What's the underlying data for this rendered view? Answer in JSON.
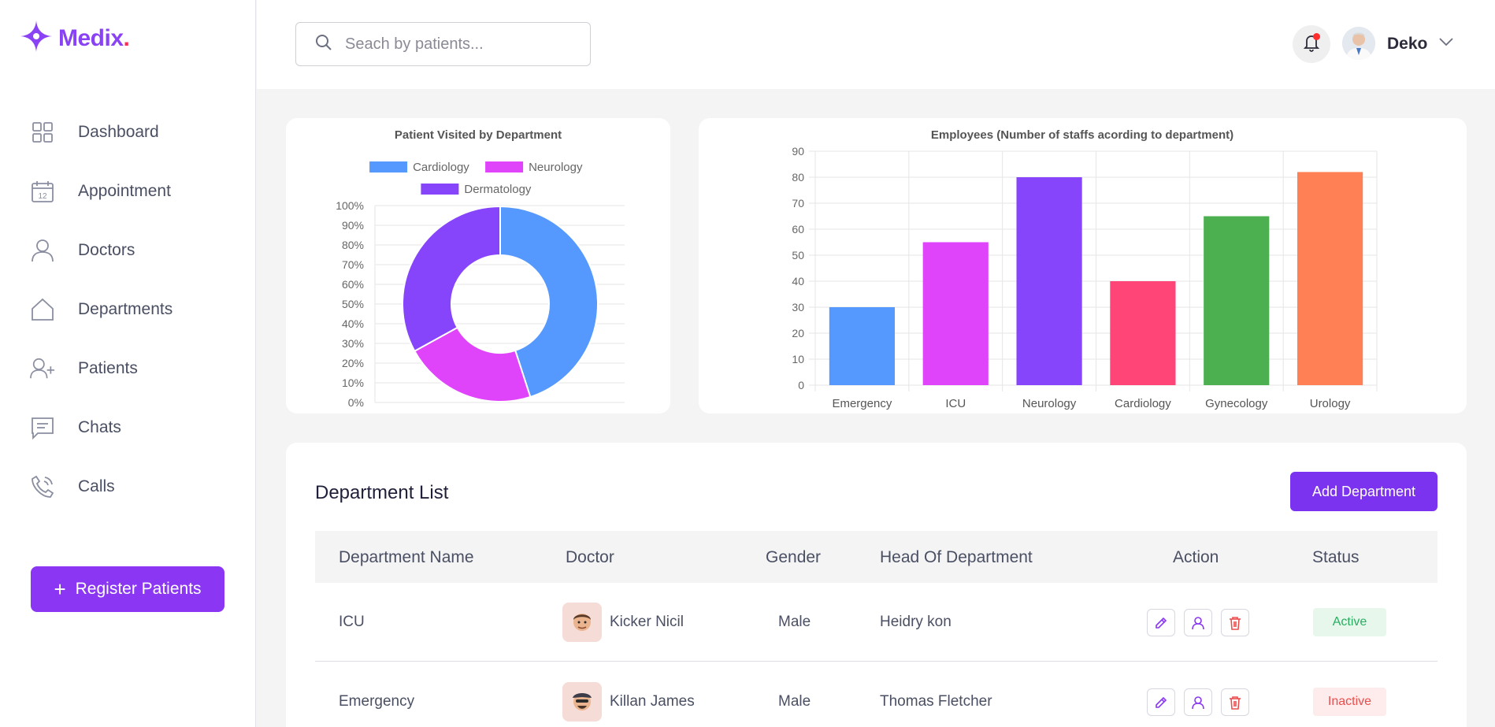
{
  "brand": {
    "name": "Medix",
    "dot": "."
  },
  "sidebar": {
    "items": [
      {
        "label": "Dashboard",
        "icon": "grid-icon"
      },
      {
        "label": "Appointment",
        "icon": "calendar-icon"
      },
      {
        "label": "Doctors",
        "icon": "user-icon"
      },
      {
        "label": "Departments",
        "icon": "home-icon"
      },
      {
        "label": "Patients",
        "icon": "user-plus-icon"
      },
      {
        "label": "Chats",
        "icon": "chat-icon"
      },
      {
        "label": "Calls",
        "icon": "phone-icon"
      }
    ],
    "calendar_day": "12",
    "register_label": "Register Patients"
  },
  "header": {
    "search_placeholder": "Seach by patients...",
    "user_name": "Deko"
  },
  "colors": {
    "accent": "#8a36f2",
    "brand": "#8a42f5",
    "notification": "#ff2d2d"
  },
  "chart_data": [
    {
      "type": "pie",
      "title": "Patient Visited by Department",
      "categories": [
        "Cardiology",
        "Neurology",
        "Dermatology"
      ],
      "legend": [
        "Cardiology",
        "Neurology",
        "Dermatology"
      ],
      "values": [
        45,
        22,
        33
      ],
      "colors": [
        "#5599ff",
        "#df44fb",
        "#8745fb"
      ],
      "y_ticks": [
        "100%",
        "90%",
        "80%",
        "70%",
        "60%",
        "50%",
        "40%",
        "30%",
        "20%",
        "10%",
        "0%"
      ],
      "legend_labels": [
        "Cardiology",
        "Neurology",
        "Dermatology"
      ],
      "legend_position": "top",
      "grid": true
    },
    {
      "type": "bar",
      "title": "Employees (Number of staffs acording to department)",
      "categories": [
        "Emergency",
        "ICU",
        "Neurology",
        "Cardiology",
        "Gynecology",
        "Urology"
      ],
      "values": [
        30,
        55,
        80,
        40,
        65,
        82
      ],
      "colors": [
        "#5599ff",
        "#df44fb",
        "#8745fb",
        "#ff4477",
        "#4cb050",
        "#ff8055"
      ],
      "ylim": [
        0,
        90
      ],
      "y_ticks": [
        90,
        80,
        70,
        60,
        50,
        40,
        30,
        20,
        10,
        0
      ],
      "grid": true
    }
  ],
  "table": {
    "title": "Department List",
    "add_label": "Add Department",
    "headers": [
      "Department Name",
      "Doctor",
      "Gender",
      "Head Of Department",
      "Action",
      "Status"
    ],
    "rows": [
      {
        "department": "ICU",
        "doctor": "Kicker Nicil",
        "gender": "Male",
        "head": "Heidry kon",
        "status": "Active"
      },
      {
        "department": "Emergency",
        "doctor": "Killan James",
        "gender": "Male",
        "head": "Thomas Fletcher",
        "status": "Inactive"
      }
    ]
  }
}
